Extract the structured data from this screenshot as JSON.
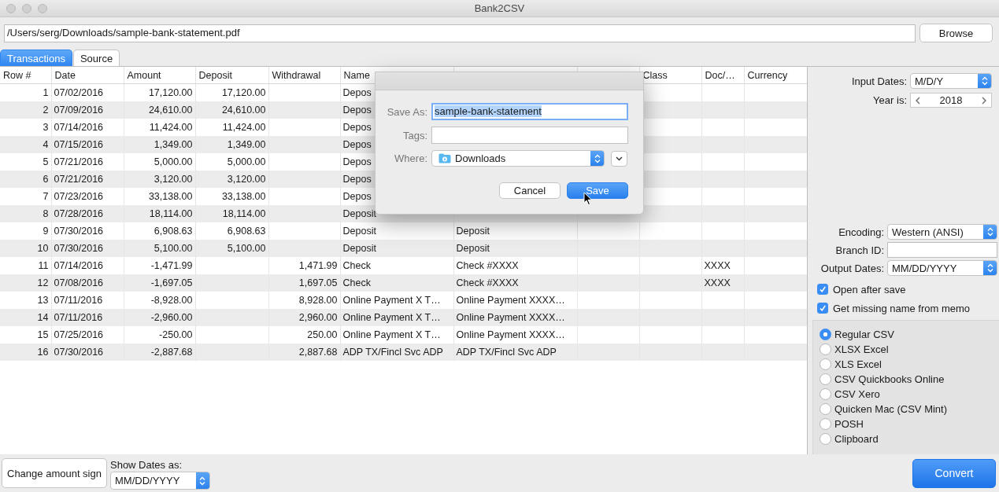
{
  "window": {
    "title": "Bank2CSV"
  },
  "file_path": {
    "value": "/Users/serg/Downloads/sample-bank-statement.pdf"
  },
  "browse_button": "Browse",
  "tabs": [
    {
      "label": "Transactions",
      "selected": true
    },
    {
      "label": "Source",
      "selected": false
    }
  ],
  "table": {
    "columns": [
      "Row #",
      "Date",
      "Amount",
      "Deposit",
      "Withdrawal",
      "Name",
      null,
      null,
      "Class",
      "Doc/…",
      "Currency"
    ],
    "rows": [
      [
        "1",
        "07/02/2016",
        "17,120.00",
        "17,120.00",
        null,
        "Depos"
      ],
      [
        "2",
        "07/09/2016",
        "24,610.00",
        "24,610.00",
        null,
        "Depos"
      ],
      [
        "3",
        "07/14/2016",
        "11,424.00",
        "11,424.00",
        null,
        "Depos"
      ],
      [
        "4",
        "07/15/2016",
        "1,349.00",
        "1,349.00",
        null,
        "Depos"
      ],
      [
        "5",
        "07/21/2016",
        "5,000.00",
        "5,000.00",
        null,
        "Depos"
      ],
      [
        "6",
        "07/21/2016",
        "3,120.00",
        "3,120.00",
        null,
        "Depos"
      ],
      [
        "7",
        "07/23/2016",
        "33,138.00",
        "33,138.00",
        null,
        "Depos"
      ],
      [
        "8",
        "07/28/2016",
        "18,114.00",
        "18,114.00",
        null,
        "Deposit"
      ],
      [
        "9",
        "07/30/2016",
        "6,908.63",
        "6,908.63",
        null,
        "Deposit",
        "Deposit"
      ],
      [
        "10",
        "07/30/2016",
        "5,100.00",
        "5,100.00",
        null,
        "Deposit",
        "Deposit"
      ],
      [
        "11",
        "07/14/2016",
        "-1,471.99",
        null,
        "1,471.99",
        "Check",
        "Check #XXXX",
        null,
        null,
        "XXXX"
      ],
      [
        "12",
        "07/08/2016",
        "-1,697.05",
        null,
        "1,697.05",
        "Check",
        "Check #XXXX",
        null,
        null,
        "XXXX"
      ],
      [
        "13",
        "07/11/2016",
        "-8,928.00",
        null,
        "8,928.00",
        "Online Payment X T…",
        "Online Payment XXXX…"
      ],
      [
        "14",
        "07/11/2016",
        "-2,960.00",
        null,
        "2,960.00",
        "Online Payment X T…",
        "Online Payment XXXX…"
      ],
      [
        "15",
        "07/25/2016",
        "-250.00",
        null,
        "250.00",
        "Online Payment X T…",
        "Online Payment XXXX…"
      ],
      [
        "16",
        "07/30/2016",
        "-2,887.68",
        null,
        "2,887.68",
        "ADP TX/Fincl Svc ADP",
        "ADP TX/Fincl Svc ADP"
      ]
    ]
  },
  "options": {
    "input_dates": {
      "label": "Input Dates:",
      "value": "M/D/Y"
    },
    "year": {
      "label": "Year is:",
      "value": "2018"
    },
    "encoding": {
      "label": "Encoding:",
      "value": "Western (ANSI)"
    },
    "branch_id": {
      "label": "Branch ID:"
    },
    "output_dates": {
      "label": "Output Dates:",
      "value": "MM/DD/YYYY"
    },
    "checkboxes": [
      {
        "label": "Open after save",
        "checked": true
      },
      {
        "label": "Get missing name from memo",
        "checked": true
      }
    ],
    "formats": [
      {
        "label": "Regular CSV",
        "selected": true
      },
      {
        "label": "XLSX Excel",
        "selected": false
      },
      {
        "label": "XLS Excel",
        "selected": false
      },
      {
        "label": "CSV Quickbooks Online",
        "selected": false
      },
      {
        "label": "CSV Xero",
        "selected": false
      },
      {
        "label": "Quicken Mac (CSV Mint)",
        "selected": false
      },
      {
        "label": "POSH",
        "selected": false
      },
      {
        "label": "Clipboard",
        "selected": false
      }
    ]
  },
  "bottom_bar": {
    "change_sign_button": "Change amount sign",
    "show_dates": {
      "label": "Show Dates as:",
      "value": "MM/DD/YYYY"
    },
    "convert_button": "Convert"
  },
  "save_dialog": {
    "save_as": {
      "label": "Save As:",
      "value": "sample-bank-statement"
    },
    "tags": {
      "label": "Tags:"
    },
    "where": {
      "label": "Where:",
      "value": "Downloads"
    },
    "buttons": [
      {
        "label": "Cancel",
        "default": false
      },
      {
        "label": "Save",
        "default": true
      }
    ]
  }
}
